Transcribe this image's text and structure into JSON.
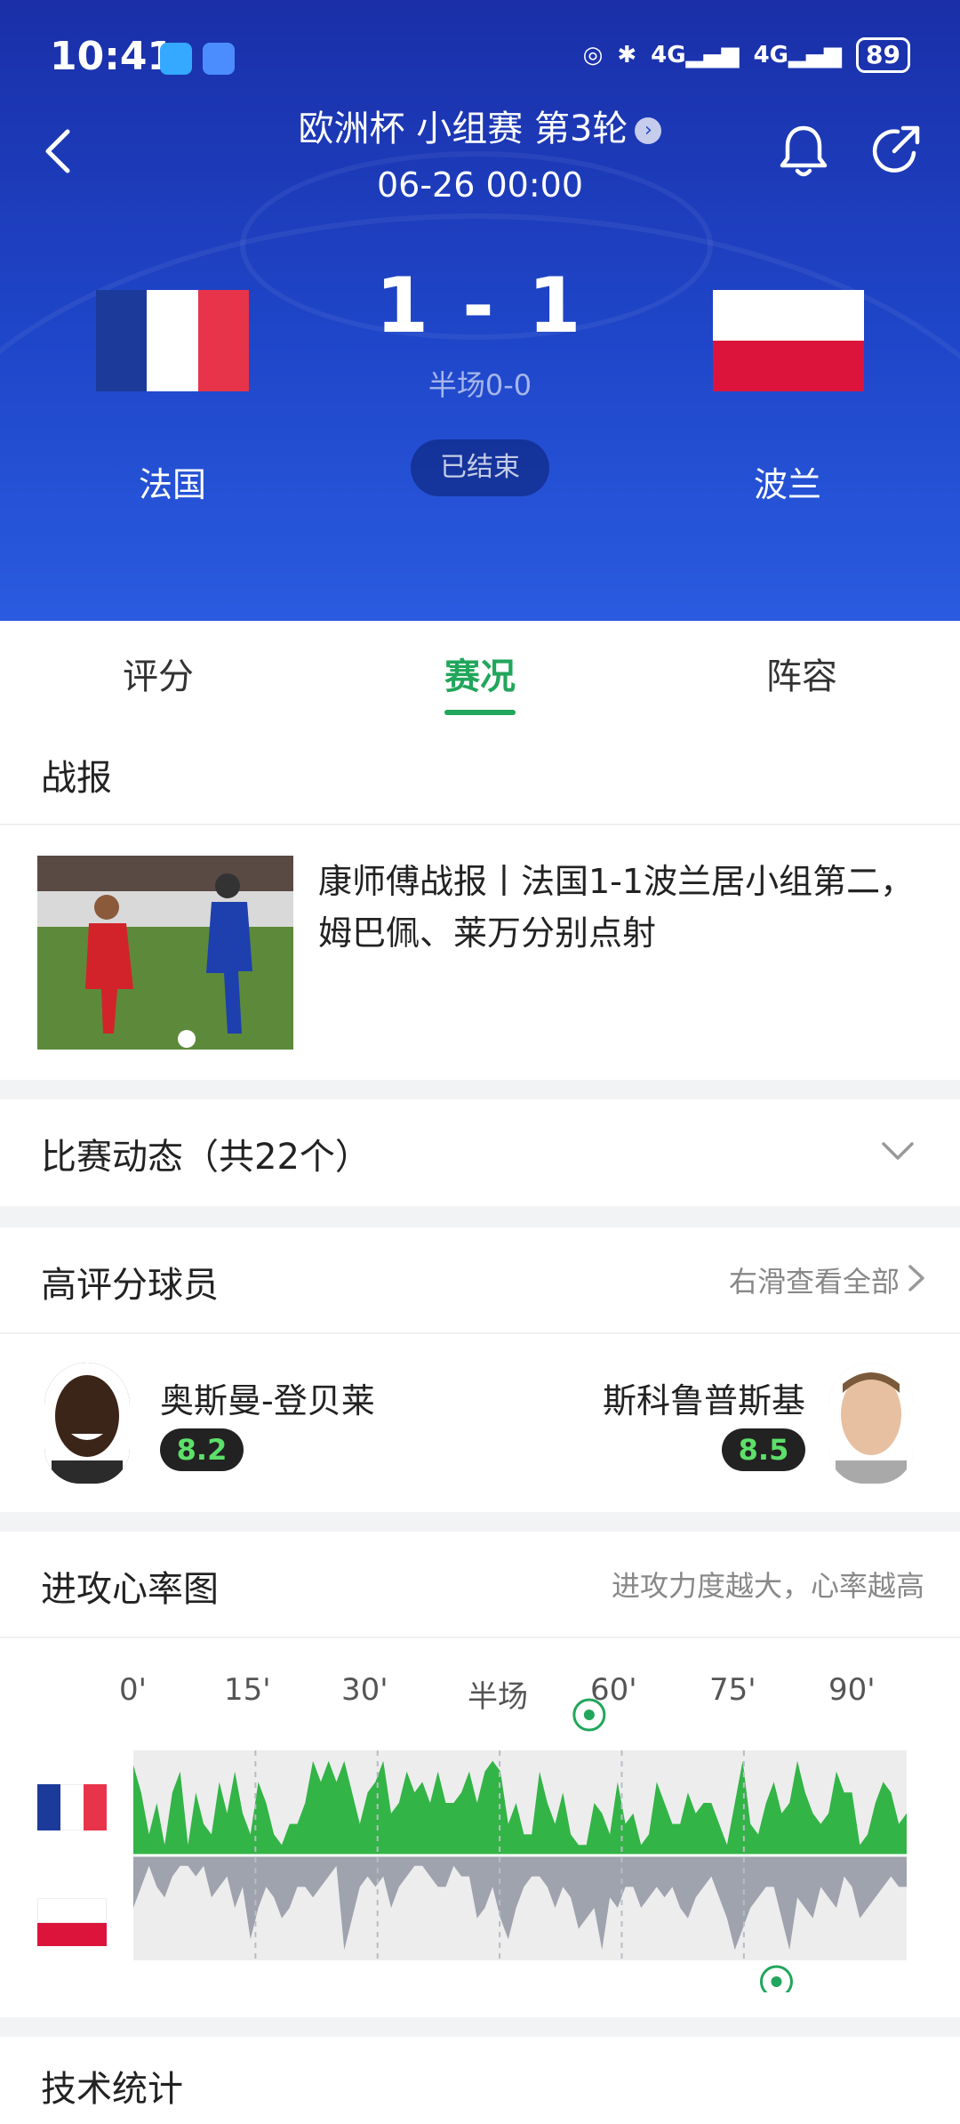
{
  "status_bar": {
    "time": "10:41",
    "battery": "89",
    "signal1": "4G",
    "signal2": "4G"
  },
  "header": {
    "competition": "欧洲杯 小组赛 第3轮",
    "datetime": "06-26 00:00",
    "home_team": "法国",
    "away_team": "波兰",
    "score": "1 - 1",
    "halftime": "半场0-0",
    "status": "已结束"
  },
  "colors": {
    "accent_green": "#21a65b",
    "hero_blue": "#1f46c9",
    "france_blue": "#1b3a9a",
    "france_red": "#e8344a",
    "poland_red": "#dc143c"
  },
  "tabs": [
    {
      "label": "评分"
    },
    {
      "label": "赛况"
    },
    {
      "label": "阵容"
    }
  ],
  "report": {
    "section_title": "战报",
    "headline": "康师傅战报丨法国1-1波兰居小组第二，姆巴佩、莱万分别点射"
  },
  "events": {
    "title": "比赛动态（共22个）"
  },
  "top_players": {
    "title": "高评分球员",
    "see_all": "右滑查看全部",
    "home_player": {
      "name": "奥斯曼-登贝莱",
      "rating": "8.2"
    },
    "away_player": {
      "name": "斯科鲁普斯基",
      "rating": "8.5"
    }
  },
  "attack_chart": {
    "title": "进攻心率图",
    "subtitle": "进攻力度越大，心率越高"
  },
  "chart_data": {
    "type": "area",
    "x_ticks": [
      "0'",
      "15'",
      "30'",
      "半场",
      "60'",
      "75'",
      "90'"
    ],
    "series": [
      {
        "team": "法国",
        "values": [
          0.86,
          0.6,
          0.2,
          0.5,
          0.1,
          0.6,
          0.8,
          0.1,
          0.6,
          0.3,
          0.2,
          0.7,
          0.4,
          0.8,
          0.4,
          0.2,
          0.7,
          0.5,
          0.2,
          0.1,
          0.3,
          0.3,
          0.5,
          0.9,
          0.7,
          0.9,
          0.7,
          0.9,
          0.6,
          0.3,
          0.6,
          0.7,
          0.9,
          0.4,
          0.5,
          0.8,
          0.6,
          0.7,
          0.5,
          0.8,
          0.5,
          0.5,
          0.6,
          0.8,
          0.5,
          0.8,
          0.9,
          0.8,
          0.3,
          0.5,
          0.2,
          0.2,
          0.8,
          0.5,
          0.3,
          0.6,
          0.2,
          0.1,
          0.1,
          0.5,
          0.4,
          0.2,
          0.7,
          0.3,
          0.4,
          0.1,
          0.2,
          0.7,
          0.5,
          0.3,
          0.3,
          0.6,
          0.4,
          0.5,
          0.5,
          0.3,
          0.1,
          0.5,
          0.9,
          0.3,
          0.2,
          0.5,
          0.7,
          0.4,
          0.5,
          0.9,
          0.6,
          0.4,
          0.3,
          0.4,
          0.8,
          0.6,
          0.6,
          0.1,
          0.2,
          0.5,
          0.7,
          0.6,
          0.3,
          0.4
        ]
      },
      {
        "team": "波兰",
        "values": [
          0.5,
          0.3,
          0.1,
          0.3,
          0.4,
          0.2,
          0.1,
          0.1,
          0.2,
          0.1,
          0.4,
          0.3,
          0.2,
          0.5,
          0.3,
          0.8,
          0.5,
          0.3,
          0.4,
          0.6,
          0.5,
          0.3,
          0.3,
          0.4,
          0.3,
          0.2,
          0.1,
          0.9,
          0.6,
          0.3,
          0.2,
          0.3,
          0.2,
          0.5,
          0.3,
          0.2,
          0.1,
          0.1,
          0.2,
          0.3,
          0.3,
          0.1,
          0.2,
          0.2,
          0.6,
          0.5,
          0.3,
          0.6,
          0.8,
          0.5,
          0.3,
          0.2,
          0.2,
          0.3,
          0.5,
          0.3,
          0.4,
          0.7,
          0.6,
          0.5,
          0.9,
          0.4,
          0.5,
          0.3,
          0.3,
          0.5,
          0.4,
          0.3,
          0.4,
          0.3,
          0.5,
          0.6,
          0.4,
          0.3,
          0.2,
          0.4,
          0.6,
          0.9,
          0.7,
          0.5,
          0.4,
          0.3,
          0.3,
          0.6,
          0.9,
          0.4,
          0.5,
          0.6,
          0.3,
          0.4,
          0.5,
          0.2,
          0.3,
          0.6,
          0.5,
          0.4,
          0.3,
          0.2,
          0.3,
          0.3
        ]
      }
    ],
    "goals": [
      {
        "team": "法国",
        "minute": 56
      },
      {
        "team": "波兰",
        "minute": 79
      }
    ]
  },
  "stats": {
    "title": "技术统计"
  }
}
